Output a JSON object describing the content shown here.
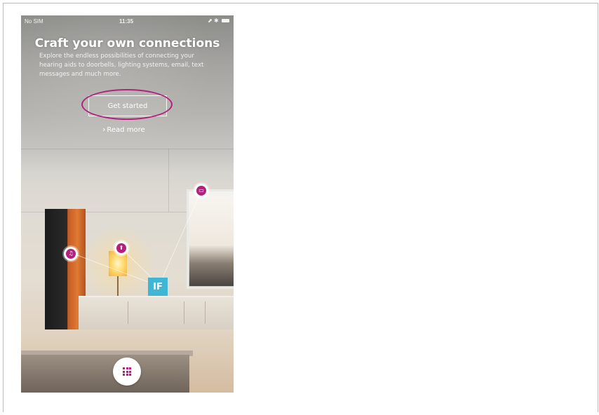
{
  "status_bar": {
    "carrier": "No SIM",
    "time": "11:35",
    "right": "⬈ ✱"
  },
  "hero": {
    "title": "Craft your own connections",
    "description": "Explore the endless possibilities of connecting your hearing aids to doorbells, lighting systems, email, text messages and much more.",
    "get_started_label": "Get started",
    "read_more_label": "Read more"
  },
  "scene": {
    "if_badge": "IF",
    "nodes": [
      {
        "name": "music-node",
        "icon": "music-note-icon",
        "glyph": "♫"
      },
      {
        "name": "lamp-node",
        "icon": "upload-arrow-icon",
        "glyph": "⬆"
      },
      {
        "name": "tv-node",
        "icon": "tv-icon",
        "glyph": "▭"
      }
    ]
  },
  "colors": {
    "accent": "#b3207d",
    "if_blue": "#3fb6d4"
  },
  "icons": {
    "menu": "grid-icon",
    "read_more_chevron": "chevron-right-icon"
  }
}
